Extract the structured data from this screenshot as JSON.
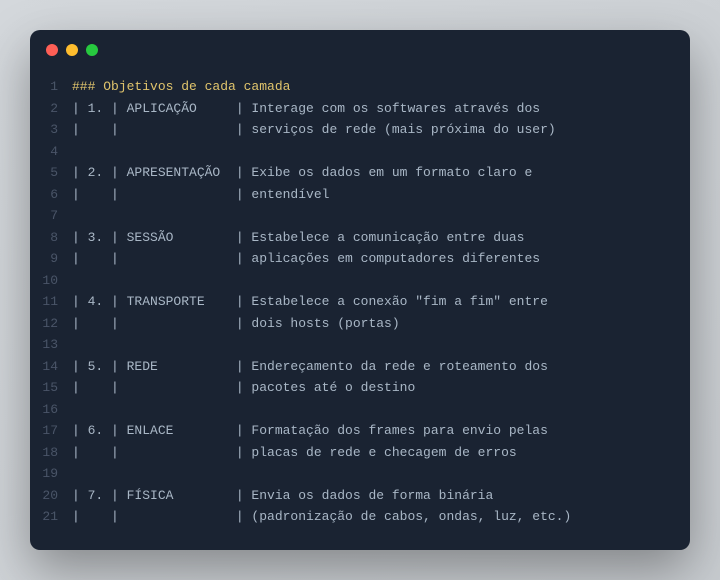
{
  "title_line": "### Objetivos de cada camada",
  "lines": [
    "| 1. | APLICAÇÃO     | Interage com os softwares através dos",
    "|    |               | serviços de rede (mais próxima do user)",
    "",
    "| 2. | APRESENTAÇÃO  | Exibe os dados em um formato claro e",
    "|    |               | entendível",
    "",
    "| 3. | SESSÃO        | Estabelece a comunicação entre duas",
    "|    |               | aplicações em computadores diferentes",
    "",
    "| 4. | TRANSPORTE    | Estabelece a conexão \"fim a fim\" entre",
    "|    |               | dois hosts (portas)",
    "",
    "| 5. | REDE          | Endereçamento da rede e roteamento dos",
    "|    |               | pacotes até o destino",
    "",
    "| 6. | ENLACE        | Formatação dos frames para envio pelas",
    "|    |               | placas de rede e checagem de erros",
    "",
    "| 7. | FÍSICA        | Envia os dados de forma binária",
    "|    |               | (padronização de cabos, ondas, luz, etc.)"
  ],
  "gutter": [
    "1",
    "2",
    "3",
    "4",
    "5",
    "6",
    "7",
    "8",
    "9",
    "10",
    "11",
    "12",
    "13",
    "14",
    "15",
    "16",
    "17",
    "18",
    "19",
    "20",
    "21"
  ]
}
